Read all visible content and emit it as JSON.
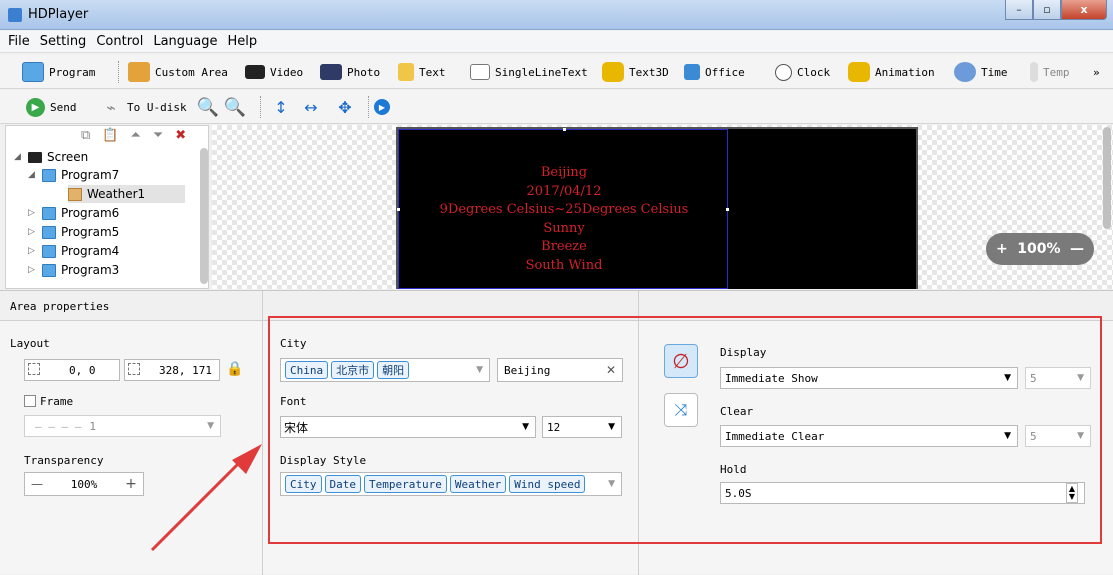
{
  "window": {
    "title": "HDPlayer",
    "controls": [
      "–",
      "▫",
      "x"
    ]
  },
  "menu": [
    "File",
    "Setting",
    "Control",
    "Language",
    "Help"
  ],
  "toolbar1": [
    {
      "label": "Program",
      "icon": "program-icon"
    },
    {
      "label": "Custom Area",
      "icon": "custom-area-icon"
    },
    {
      "label": "Video",
      "icon": "video-icon"
    },
    {
      "label": "Photo",
      "icon": "photo-icon"
    },
    {
      "label": "Text",
      "icon": "text-icon"
    },
    {
      "label": "SingleLineText",
      "icon": "single-line-text-icon"
    },
    {
      "label": "Text3D",
      "icon": "text3d-icon"
    },
    {
      "label": "Office",
      "icon": "office-icon"
    },
    {
      "label": "Clock",
      "icon": "clock-icon"
    },
    {
      "label": "Animation",
      "icon": "animation-icon"
    },
    {
      "label": "Time",
      "icon": "time-icon"
    },
    {
      "label": "Temp",
      "icon": "temp-icon"
    },
    {
      "label": "»",
      "icon": "overflow-icon"
    }
  ],
  "toolbar2": {
    "send": "Send",
    "to_udisk": "To U-disk"
  },
  "tree": {
    "screen": "Screen",
    "program7": "Program7",
    "weather1": "Weather1",
    "program6": "Program6",
    "program5": "Program5",
    "program4": "Program4",
    "program3": "Program3"
  },
  "preview": {
    "lines": [
      "Beijing",
      "2017/04/12",
      "9Degrees Celsius~25Degrees Celsius",
      "Sunny",
      "Breeze",
      "South Wind"
    ],
    "zoom": "100%",
    "zoom_minus": "—",
    "zoom_plus": "+"
  },
  "props": {
    "header": "Area properties",
    "layout_label": "Layout",
    "layout_pos": "0, 0",
    "layout_size": "328, 171",
    "frame_label": "Frame",
    "frame_value": "1",
    "transparency_label": "Transparency",
    "transparency_value": "100%",
    "city_label": "City",
    "city_chips": [
      "China",
      "北京市",
      "朝阳"
    ],
    "city_value": "Beijing",
    "font_label": "Font",
    "font_value": "宋体",
    "font_size": "12",
    "display_style_label": "Display Style",
    "display_style_chips": [
      "City",
      "Date",
      "Temperature",
      "Weather",
      "Wind speed"
    ],
    "display_label": "Display",
    "display_value": "Immediate Show",
    "display_speed": "5",
    "clear_label": "Clear",
    "clear_value": "Immediate Clear",
    "clear_speed": "5",
    "hold_label": "Hold",
    "hold_value": "5.0S"
  },
  "colors": {
    "led_text": "#d4202a",
    "accent": "#3c8fd8",
    "highlight_box": "#e03a3a"
  }
}
